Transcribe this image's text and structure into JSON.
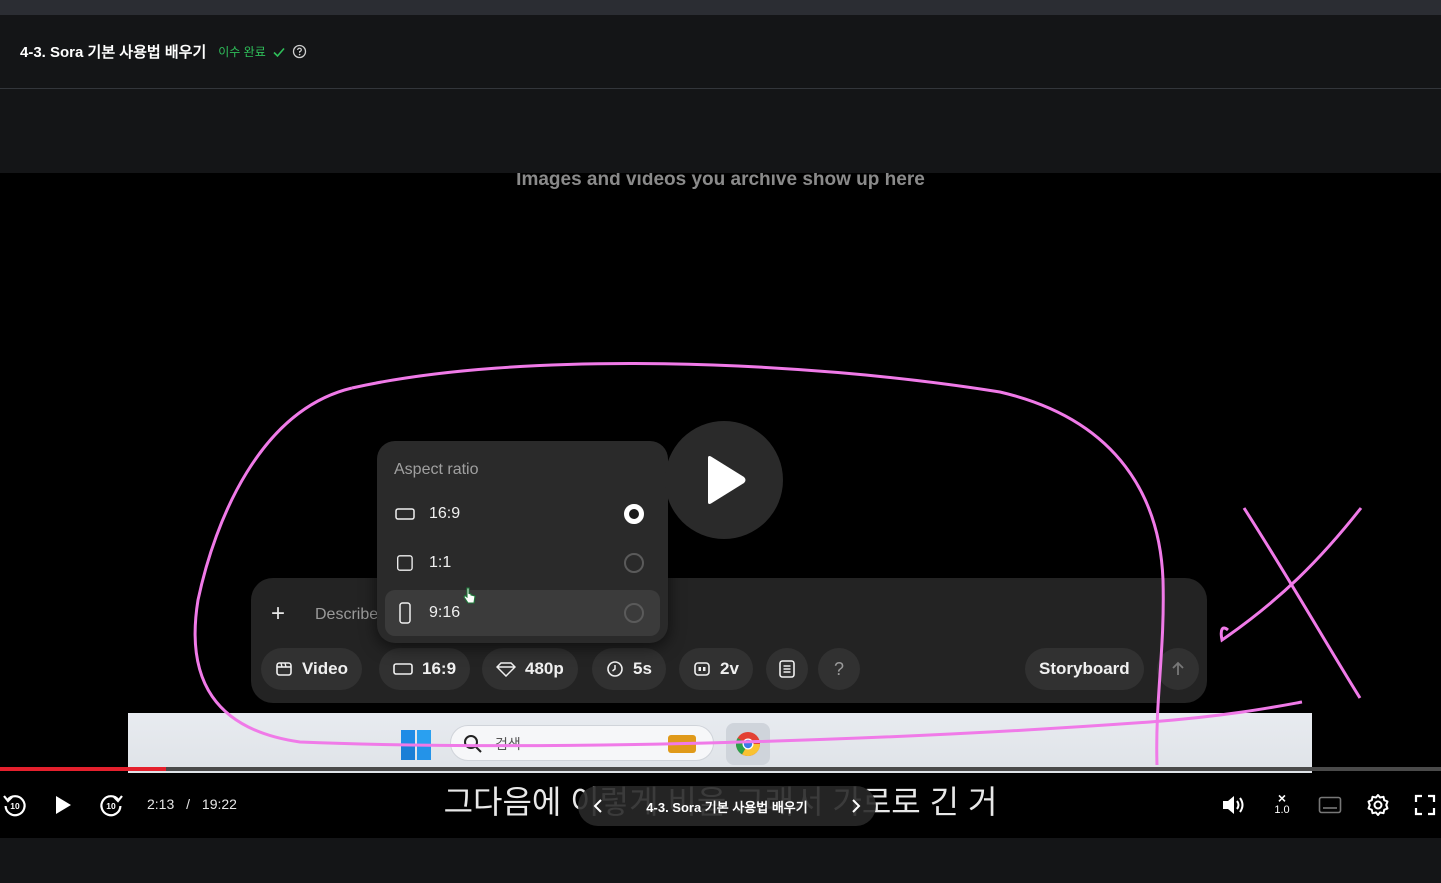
{
  "header": {
    "lesson_title": "4-3. Sora 기본 사용법 배우기",
    "status": "이수 완료"
  },
  "video": {
    "archive_text": "Images and videos you archive show up here",
    "aspect_popup": {
      "title": "Aspect ratio",
      "options": [
        {
          "label": "16:9",
          "selected": true
        },
        {
          "label": "1:1",
          "selected": false
        },
        {
          "label": "9:16",
          "selected": false
        }
      ]
    },
    "composer": {
      "placeholder": "Describe",
      "chips": {
        "video": "Video",
        "ratio": "16:9",
        "resolution": "480p",
        "duration": "5s",
        "variations": "2v",
        "help": "?",
        "storyboard": "Storyboard"
      }
    },
    "taskbar": {
      "search_text": "검색"
    }
  },
  "player": {
    "caption": "그다음에 이렇게 비율 그래서 가로로 긴 거",
    "pill_title": "4-3. Sora 기본 사용법 배우기",
    "current_time": "2:13",
    "separator": "/",
    "duration": "19:22",
    "progress": 0.115,
    "speed_mark": "×",
    "speed": "1.0",
    "rewind_label": "10",
    "forward_label": "10"
  },
  "colors": {
    "accent_green": "#2fbf5a",
    "progress_red": "#e5202d",
    "annotation_pink": "#f07ae8"
  }
}
